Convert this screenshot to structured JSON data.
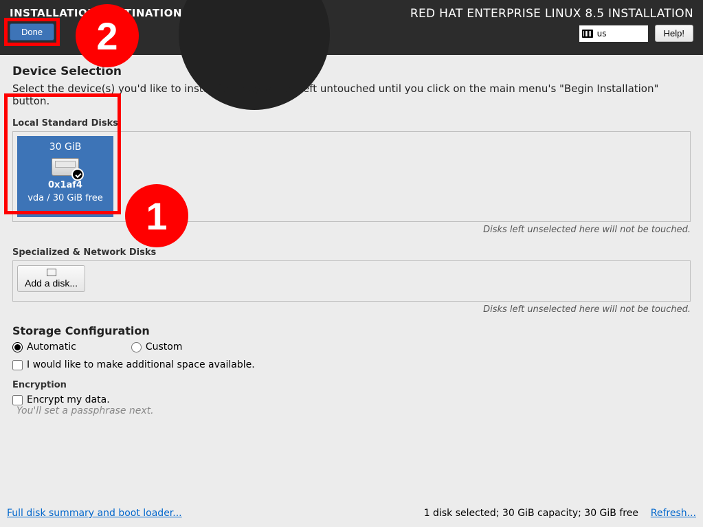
{
  "header": {
    "page_title": "INSTALLATION DESTINATION",
    "done_label": "Done",
    "install_title": "RED HAT ENTERPRISE LINUX 8.5 INSTALLATION",
    "keyboard_layout": "us",
    "help_label": "Help!"
  },
  "device_selection": {
    "heading": "Device Selection",
    "description": "Select the device(s) you'd like to install to.  They will be left untouched until you click on the main menu's \"Begin Installation\" button."
  },
  "local_disks": {
    "label": "Local Standard Disks",
    "note": "Disks left unselected here will not be touched.",
    "disk": {
      "size": "30 GiB",
      "model": "0x1af4",
      "free": "vda  /  30 GiB free"
    }
  },
  "network_disks": {
    "label": "Specialized & Network Disks",
    "add_label": "Add a disk...",
    "note": "Disks left unselected here will not be touched."
  },
  "storage_config": {
    "heading": "Storage Configuration",
    "auto_label": "Automatic",
    "custom_label": "Custom",
    "extra_space_label": "I would like to make additional space available."
  },
  "encryption": {
    "heading": "Encryption",
    "encrypt_label": "Encrypt my data.",
    "hint": "You'll set a passphrase next."
  },
  "footer": {
    "summary_link": "Full disk summary and boot loader...",
    "status": "1 disk selected; 30 GiB capacity; 30 GiB free",
    "refresh_link": "Refresh..."
  },
  "annotations": {
    "a1": "1",
    "a2": "2"
  }
}
